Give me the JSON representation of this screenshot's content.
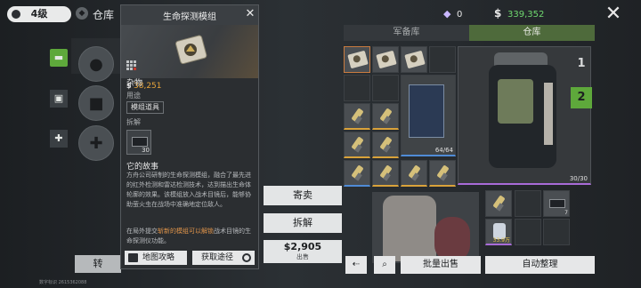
{
  "top": {
    "level": "4级",
    "title": "仓库",
    "gems": "0",
    "coins": "339,352"
  },
  "tooltip": {
    "title": "生命探测模组",
    "price": "38,251",
    "category": "杂物",
    "usage_label": "用途",
    "usage_tag": "模组道具",
    "disassemble_label": "拆解",
    "disassemble_count": "30",
    "story_label": "它的故事",
    "story_text": "方舟公司研制的生命探测模组，融合了最先进的红外检测和雷达检测技术，达到描出生命体轮廓的效果。该模组放入战术目镜后，能够协助萤火虫在战场中准确地定位敌人。",
    "story_text2_pre": "在局外提交",
    "story_text2_hl": "斩新的模组可以解锁",
    "story_text2_post": "战术目镜的生命探测仪功能。",
    "btn_map": "地图攻略",
    "btn_get": "获取途径"
  },
  "actions": {
    "sell": "寄卖",
    "split": "拆解",
    "price": "2,905",
    "price_label": "出售"
  },
  "storage": {
    "tab_left": "军备库",
    "tab_right": "仓库",
    "case_count": "64/64",
    "backpack_count": "30/30",
    "page1": "1",
    "page2": "2",
    "item_count_7": "7",
    "item_weight": "33.9万"
  },
  "bottom": {
    "left_btn": "转",
    "bulk_sell": "批量出售",
    "auto_sort": "自动整理",
    "version": "数字标识 2615362088"
  }
}
